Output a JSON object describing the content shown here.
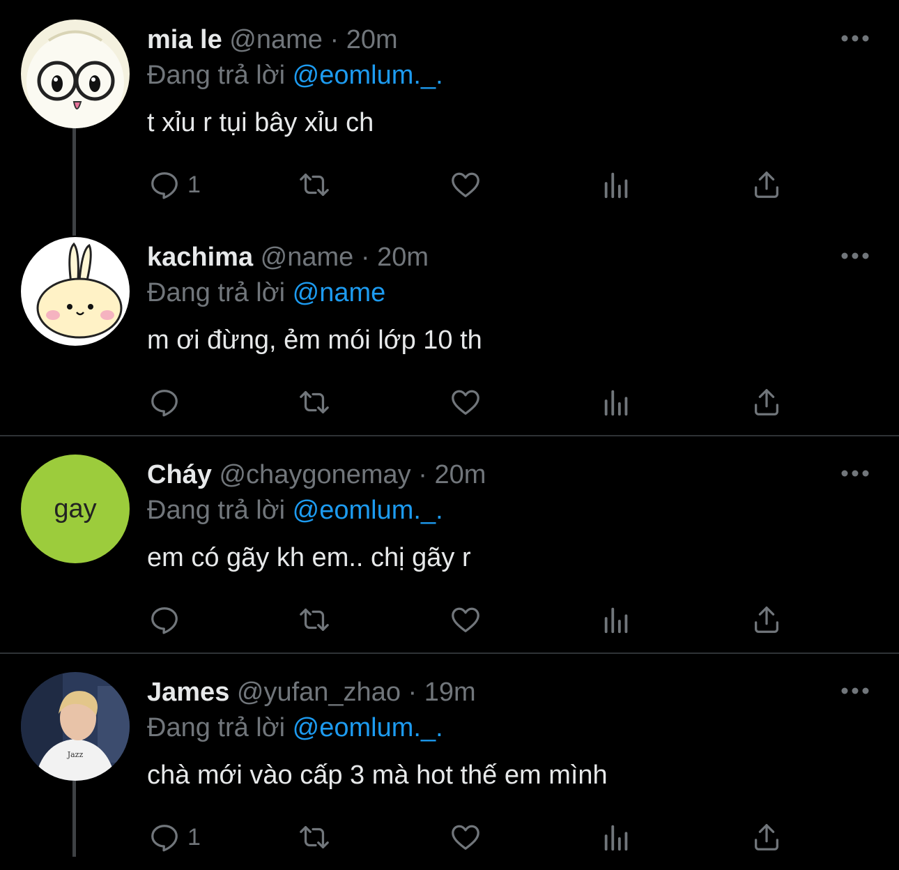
{
  "reply_prefix": "Đang trả lời",
  "tweets": [
    {
      "display_name": "mia le",
      "handle": "@name",
      "separator": "·",
      "time": "20m",
      "reply_to": "@eomlum._.",
      "text": "t xỉu r tụi bây xỉu ch",
      "reply_count": "1",
      "avatar_icon": "glasses-character-avatar"
    },
    {
      "display_name": "kachima",
      "handle": "@name",
      "separator": "·",
      "time": "20m",
      "reply_to": "@name",
      "text": "m ơi đừng, ẻm mói lớp 10 th",
      "reply_count": "",
      "avatar_icon": "bunny-character-avatar"
    },
    {
      "display_name": "Cháy",
      "handle": "@chaygonemay",
      "separator": "·",
      "time": "20m",
      "reply_to": "@eomlum._.",
      "text": "em có gãy kh em.. chị gãy r",
      "reply_count": "",
      "avatar_text": "gay",
      "avatar_color": "#9ccc3c"
    },
    {
      "display_name": "James",
      "handle": "@yufan_zhao",
      "separator": "·",
      "time": "19m",
      "reply_to": "@eomlum._.",
      "text": "chà mới vào cấp 3 mà hot thế em mình",
      "reply_count": "1",
      "avatar_icon": "person-photo-avatar"
    }
  ],
  "colors": {
    "background": "#000000",
    "primary_text": "#e7e9ea",
    "secondary_text": "#71767b",
    "link": "#1d9bf0",
    "separator": "#2f3336"
  },
  "icons": {
    "reply": "reply-icon",
    "retweet": "retweet-icon",
    "like": "heart-icon",
    "views": "views-icon",
    "share": "share-icon",
    "more": "more-options-icon"
  }
}
